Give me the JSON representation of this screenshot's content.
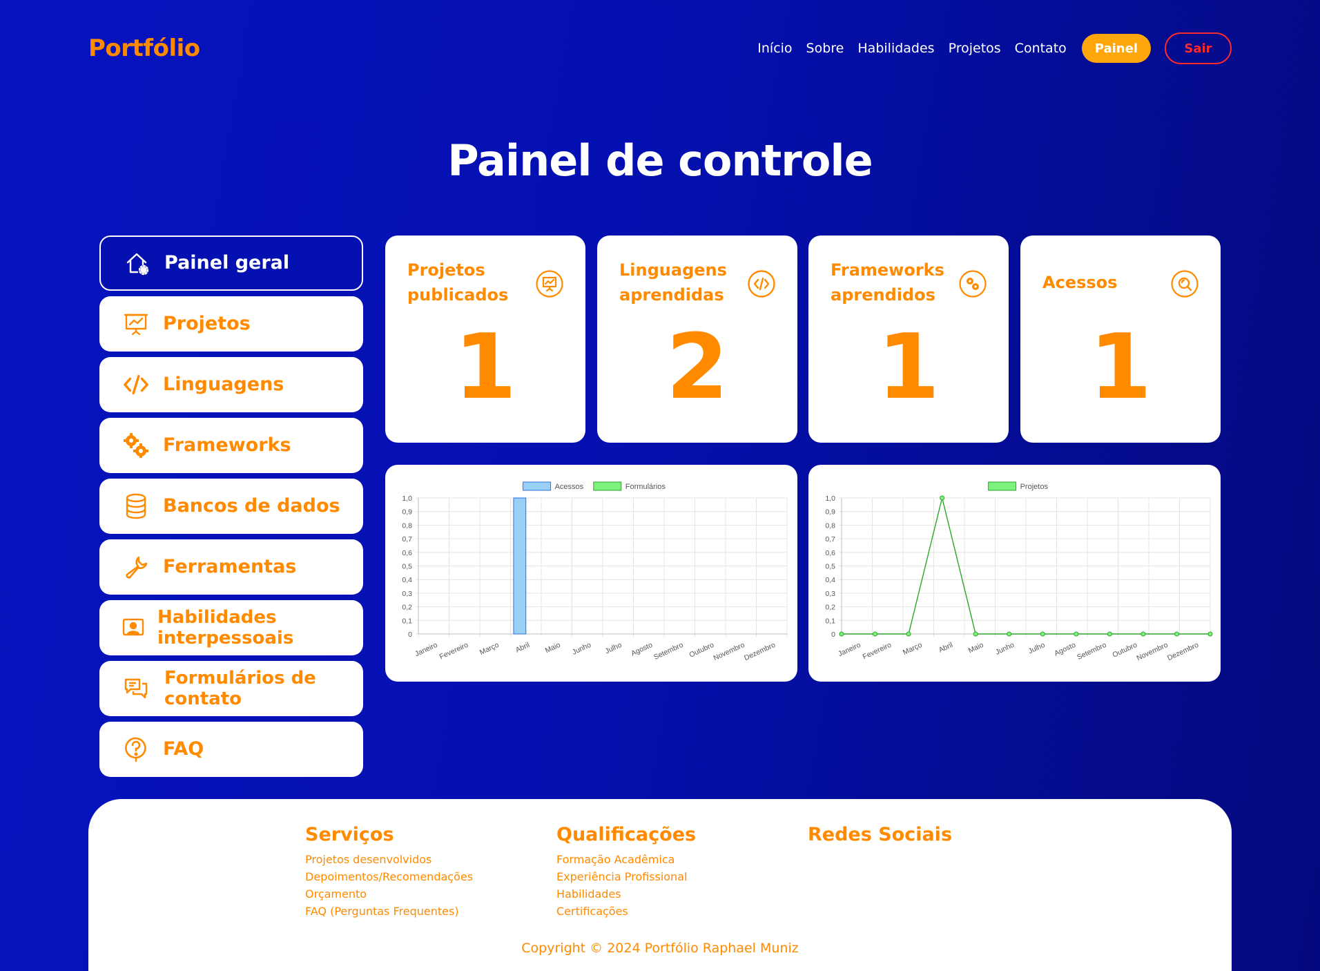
{
  "nav": {
    "logo": "Portfólio",
    "links": [
      "Início",
      "Sobre",
      "Habilidades",
      "Projetos",
      "Contato"
    ],
    "painel_label": "Painel",
    "sair_label": "Sair"
  },
  "page_title": "Painel de controle",
  "sidebar": {
    "items": [
      {
        "label": "Painel geral",
        "icon": "home-gear-icon"
      },
      {
        "label": "Projetos",
        "icon": "presentation-chart-icon"
      },
      {
        "label": "Linguagens",
        "icon": "code-icon"
      },
      {
        "label": "Frameworks",
        "icon": "gears-icon"
      },
      {
        "label": "Bancos de dados",
        "icon": "database-icon"
      },
      {
        "label": "Ferramentas",
        "icon": "wrench-icon"
      },
      {
        "label": "Habilidades interpessoais",
        "icon": "person-screen-icon"
      },
      {
        "label": "Formulários de contato",
        "icon": "chat-icon"
      },
      {
        "label": "FAQ",
        "icon": "question-icon"
      }
    ]
  },
  "stats": [
    {
      "title": "Projetos publicados",
      "value": "1",
      "icon": "presentation-chart-icon"
    },
    {
      "title": "Linguagens aprendidas",
      "value": "2",
      "icon": "code-icon"
    },
    {
      "title": "Frameworks aprendidos",
      "value": "1",
      "icon": "gears-icon"
    },
    {
      "title": "Acessos",
      "value": "1",
      "icon": "search-icon"
    }
  ],
  "chart_data": [
    {
      "type": "bar",
      "categories": [
        "Janeiro",
        "Fevereiro",
        "Março",
        "Abril",
        "Maio",
        "Junho",
        "Julho",
        "Agosto",
        "Setembro",
        "Outubro",
        "Novembro",
        "Dezembro"
      ],
      "series": [
        {
          "name": "Acessos",
          "values": [
            0,
            0,
            0,
            1,
            0,
            0,
            0,
            0,
            0,
            0,
            0,
            0
          ],
          "color": "#9ad0f5",
          "border": "#2f6fe0"
        },
        {
          "name": "Formulários",
          "values": [
            0,
            0,
            0,
            0,
            0,
            0,
            0,
            0,
            0,
            0,
            0,
            0
          ],
          "color": "#7ef07e",
          "border": "#2aa82a"
        }
      ],
      "ylim": [
        0,
        1
      ],
      "yticks": [
        "0",
        "0,1",
        "0,2",
        "0,3",
        "0,4",
        "0,5",
        "0,6",
        "0,7",
        "0,8",
        "0,9",
        "1,0"
      ],
      "legend": "top-center",
      "grid": true
    },
    {
      "type": "line",
      "categories": [
        "Janeiro",
        "Fevereiro",
        "Março",
        "Abril",
        "Maio",
        "Junho",
        "Julho",
        "Agosto",
        "Setembro",
        "Outubro",
        "Novembro",
        "Dezembro"
      ],
      "series": [
        {
          "name": "Projetos",
          "values": [
            0,
            0,
            0,
            1,
            0,
            0,
            0,
            0,
            0,
            0,
            0,
            0
          ],
          "color": "#7ef07e",
          "border": "#2aa82a"
        }
      ],
      "ylim": [
        0,
        1
      ],
      "yticks": [
        "0",
        "0,1",
        "0,2",
        "0,3",
        "0,4",
        "0,5",
        "0,6",
        "0,7",
        "0,8",
        "0,9",
        "1,0"
      ],
      "legend": "top-center",
      "grid": true
    }
  ],
  "footer": {
    "servicos": {
      "title": "Serviços",
      "links": [
        "Projetos desenvolvidos",
        "Depoimentos/Recomendações",
        "Orçamento",
        "FAQ (Perguntas Frequentes)"
      ]
    },
    "qualificacoes": {
      "title": "Qualificações",
      "links": [
        "Formação Acadêmica",
        "Experiência Profissional",
        "Habilidades",
        "Certificações"
      ]
    },
    "redes": {
      "title": "Redes Sociais"
    },
    "copyright": "Copyright © 2024 Portfólio Raphael Muniz"
  }
}
